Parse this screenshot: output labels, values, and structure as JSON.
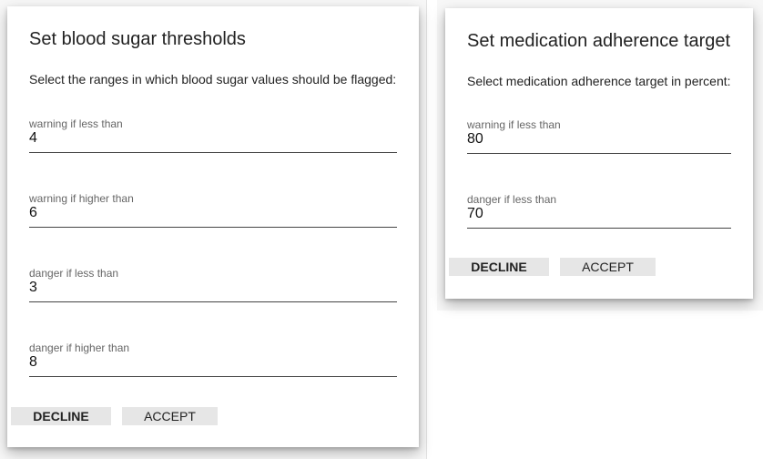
{
  "blood_sugar_dialog": {
    "title": "Set blood sugar thresholds",
    "description": "Select the ranges in which blood sugar values should be flagged:",
    "fields": [
      {
        "label": "warning if less than",
        "value": "4"
      },
      {
        "label": "warning if higher than",
        "value": "6"
      },
      {
        "label": "danger if less than",
        "value": "3"
      },
      {
        "label": "danger if higher than",
        "value": "8"
      }
    ],
    "decline_label": "DECLINE",
    "accept_label": "ACCEPT"
  },
  "medication_dialog": {
    "title": "Set medication adherence target",
    "description": "Select medication adherence target in percent:",
    "fields": [
      {
        "label": "warning if less than",
        "value": "80"
      },
      {
        "label": "danger if less than",
        "value": "70"
      }
    ],
    "decline_label": "DECLINE",
    "accept_label": "ACCEPT"
  }
}
